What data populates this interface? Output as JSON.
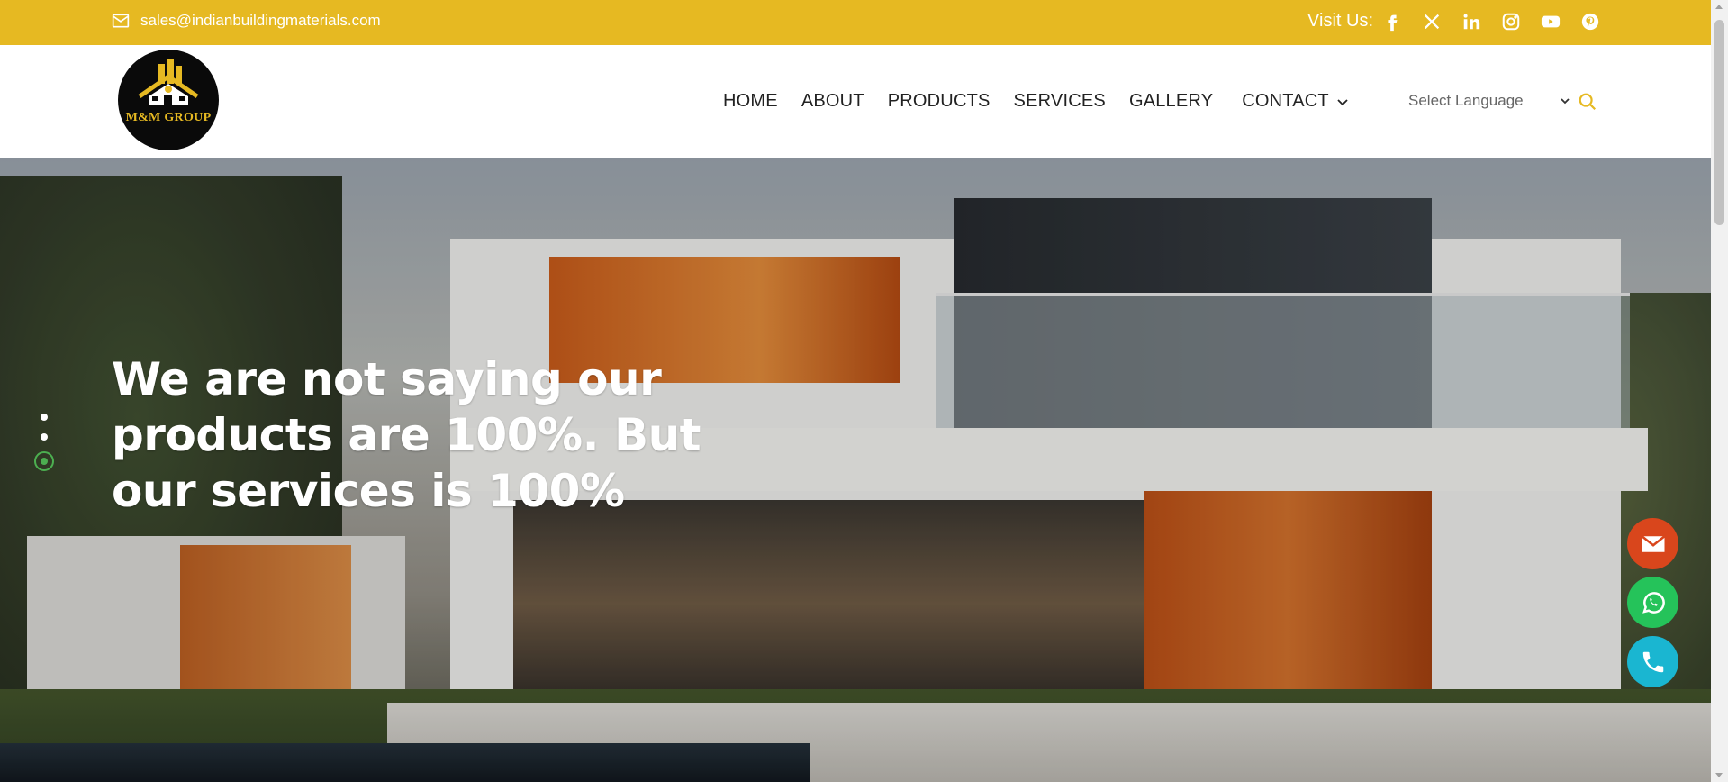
{
  "topbar": {
    "email": "sales@indianbuildingmaterials.com",
    "visit_label": "Visit Us:",
    "social_icons": [
      "facebook-icon",
      "x-twitter-icon",
      "linkedin-icon",
      "instagram-icon",
      "youtube-icon",
      "pinterest-icon"
    ],
    "bg_color": "#e6b922"
  },
  "header": {
    "logo_text": "M&M GROUP",
    "nav": {
      "home": "HOME",
      "about": "ABOUT",
      "products": "PRODUCTS",
      "services": "SERVICES",
      "gallery": "GALLERY",
      "contact": "CONTACT"
    },
    "language_select": "Select Language",
    "search_icon": "search-icon"
  },
  "hero": {
    "headline": "We are not saying our products are 100%. But our services is 100%",
    "slider_dots": 3,
    "active_dot": 3
  },
  "floating_buttons": {
    "mail": "mail-icon",
    "whatsapp": "whatsapp-icon",
    "phone": "phone-icon",
    "colors": {
      "mail": "#d9461c",
      "whatsapp": "#25c35a",
      "phone": "#1ab6d1"
    }
  },
  "colors": {
    "accent": "#e6b922"
  }
}
